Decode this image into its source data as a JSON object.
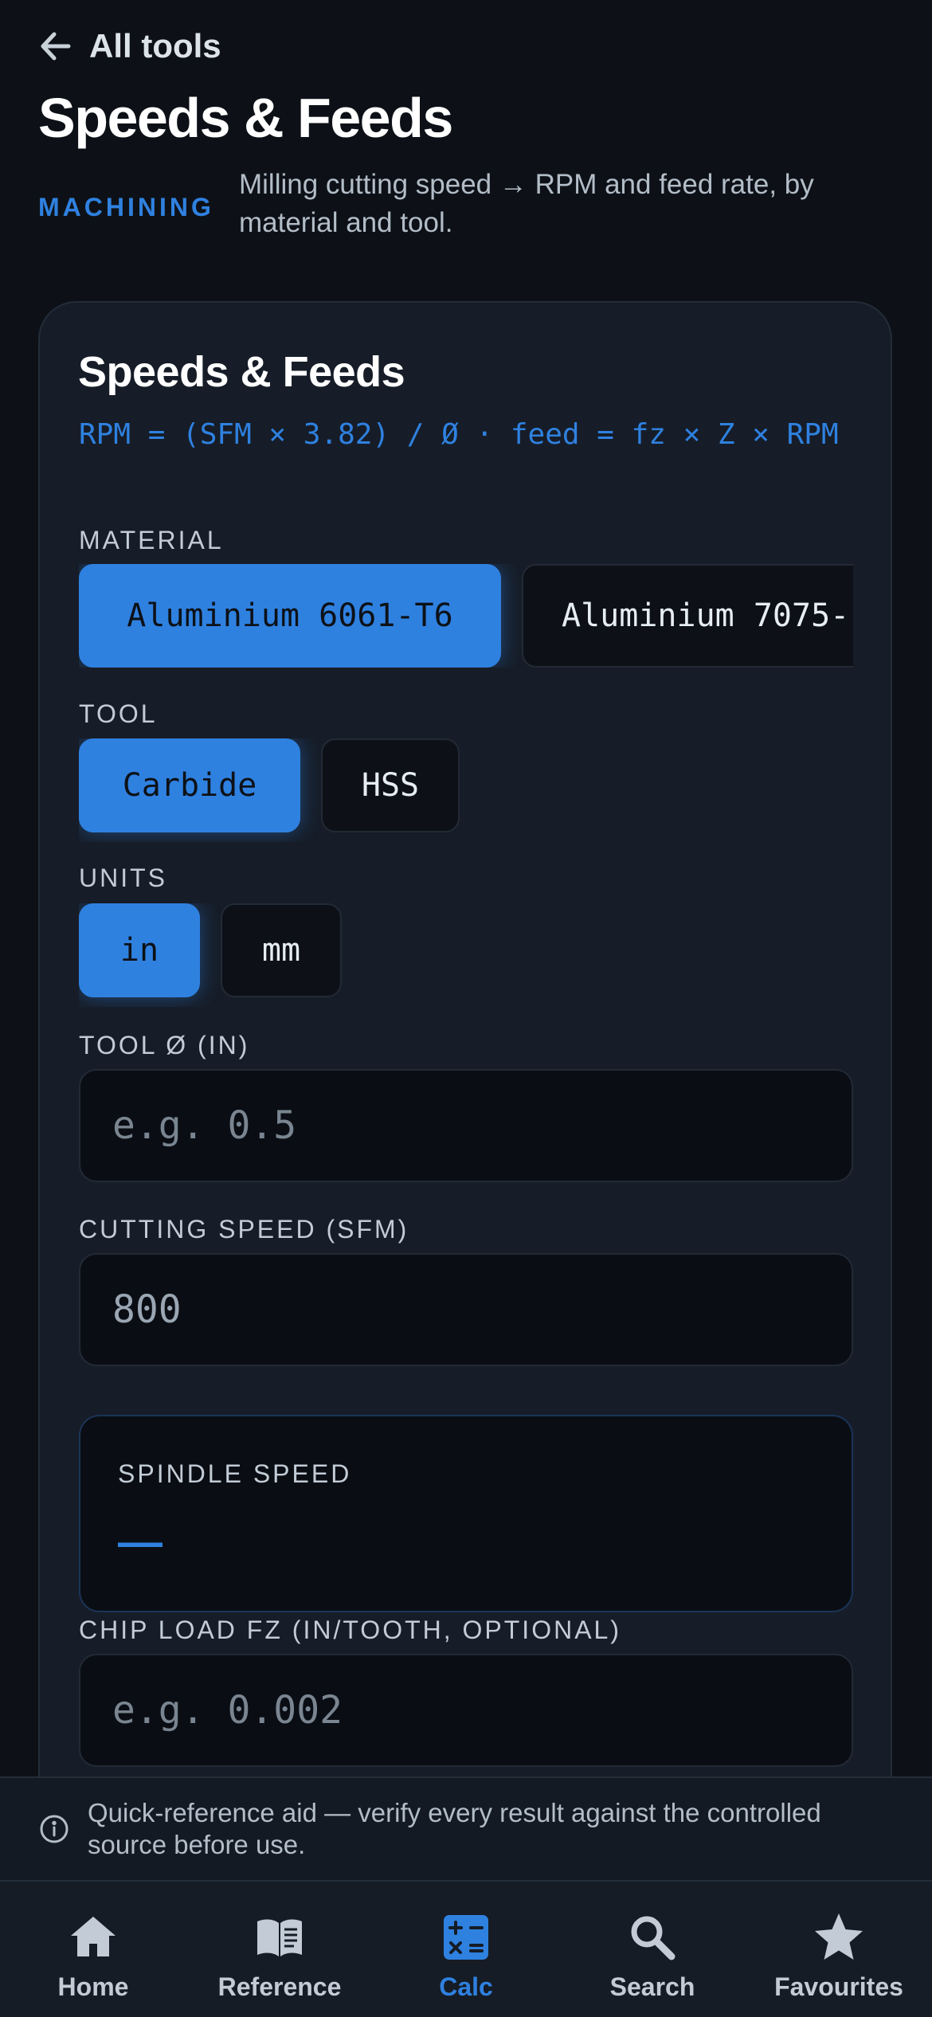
{
  "header": {
    "back_label": "All tools",
    "title": "Speeds & Feeds",
    "category": "MACHINING",
    "subtitle": "Milling cutting speed → RPM and feed rate, by material and tool."
  },
  "card": {
    "title": "Speeds & Feeds",
    "formula": "RPM = (SFM × 3.82) / Ø    ·    feed = fz × Z × RPM",
    "material": {
      "label": "MATERIAL",
      "options": [
        "Aluminium 6061-T6",
        "Aluminium 7075-"
      ],
      "selected": "Aluminium 6061-T6"
    },
    "tool": {
      "label": "TOOL",
      "options": [
        "Carbide",
        "HSS"
      ],
      "selected": "Carbide"
    },
    "units": {
      "label": "UNITS",
      "options": [
        "in",
        "mm"
      ],
      "selected": "in"
    },
    "tool_diameter": {
      "label": "TOOL Ø (IN)",
      "value": "",
      "placeholder": "e.g. 0.5"
    },
    "cutting_speed": {
      "label": "CUTTING SPEED (SFM)",
      "value": "800",
      "placeholder": ""
    },
    "spindle_speed": {
      "label": "SPINDLE SPEED",
      "value": "—"
    },
    "chip_load": {
      "label": "CHIP LOAD FZ (IN/TOOTH, OPTIONAL)",
      "value": "",
      "placeholder": "e.g. 0.002"
    }
  },
  "disclaimer": {
    "icon": "info-icon",
    "text": "Quick-reference aid — verify every result against the controlled source before use."
  },
  "tab_bar": {
    "active": "Calc",
    "items": [
      {
        "label": "Home",
        "icon": "home-icon"
      },
      {
        "label": "Reference",
        "icon": "book-icon"
      },
      {
        "label": "Calc",
        "icon": "calculator-icon"
      },
      {
        "label": "Search",
        "icon": "search-icon"
      },
      {
        "label": "Favourites",
        "icon": "star-icon"
      }
    ]
  },
  "colors": {
    "background": "#0d1117",
    "card": "#161d28",
    "accent": "#2f81e0",
    "muted_text": "#b3bdc8"
  }
}
